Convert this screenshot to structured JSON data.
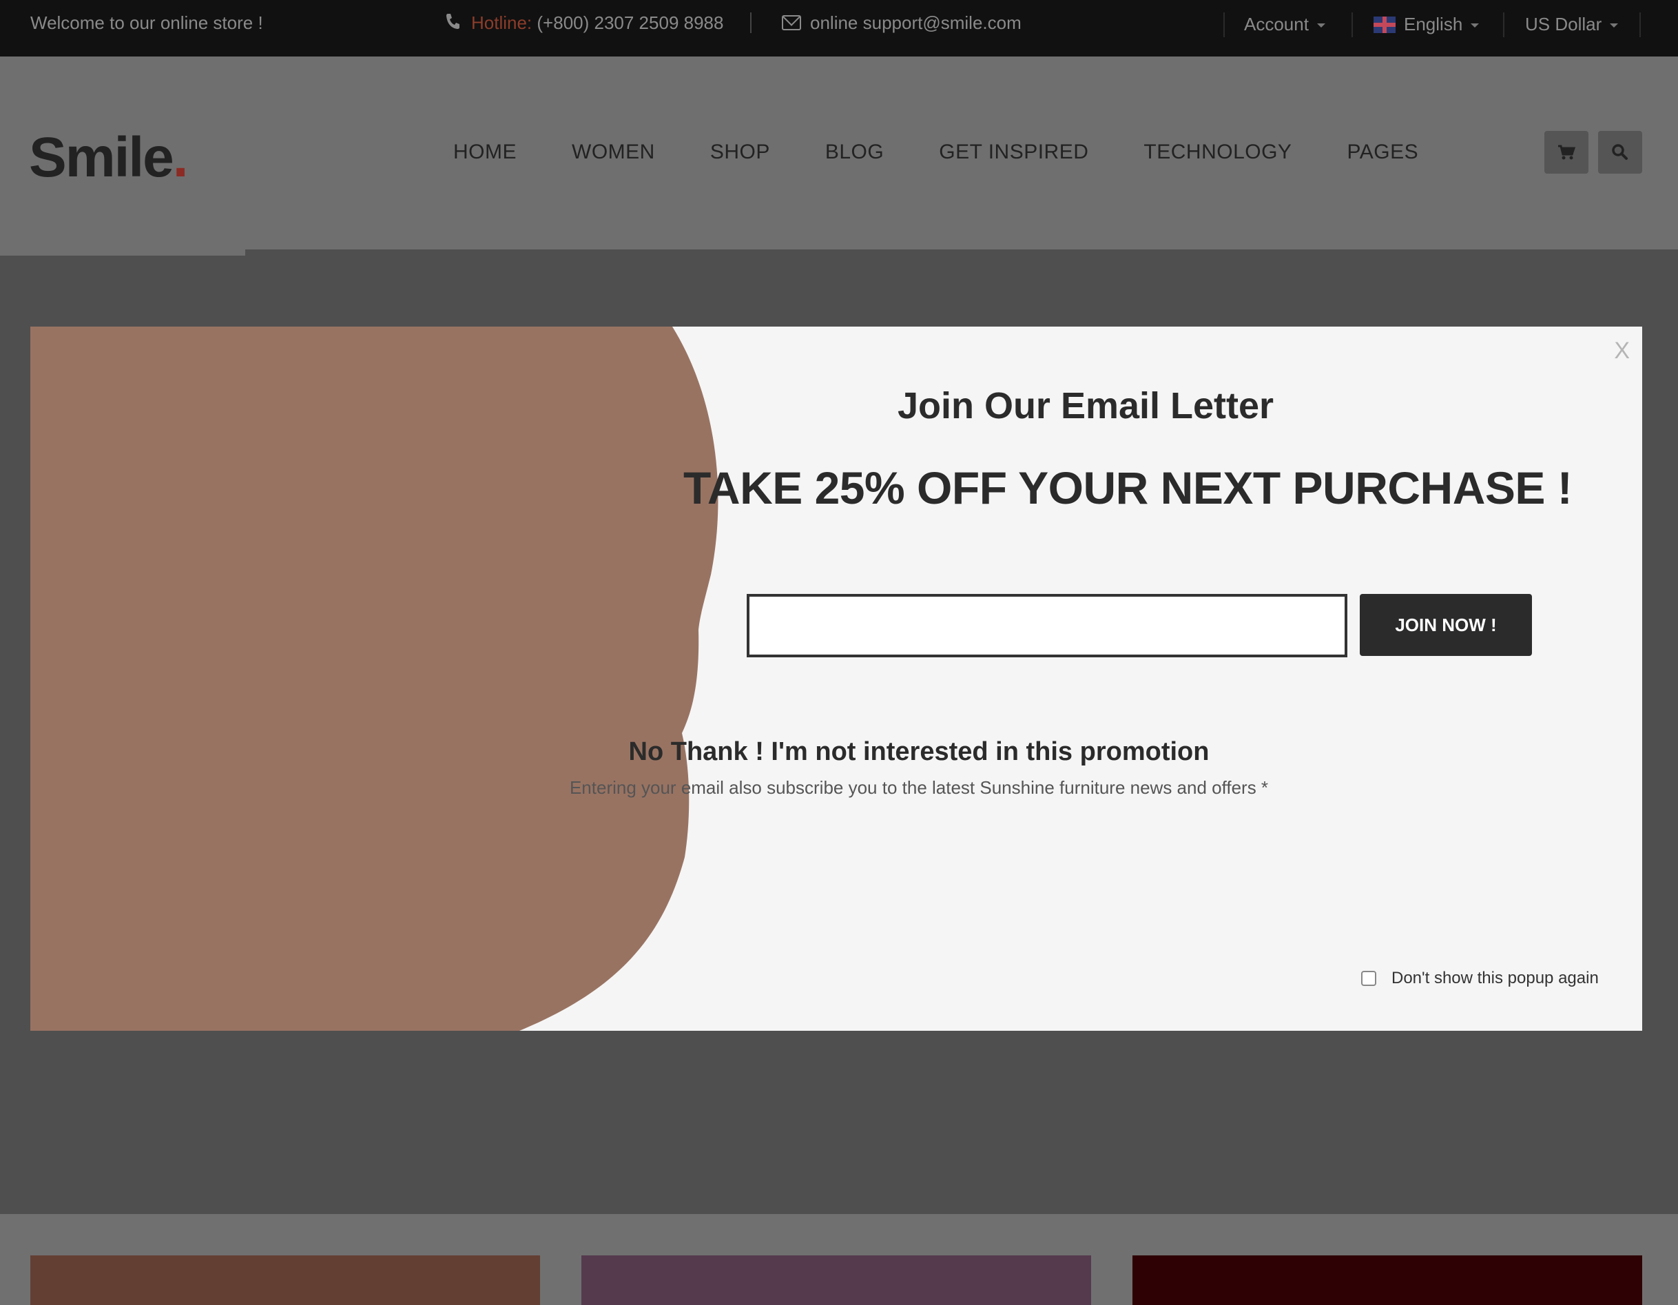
{
  "topbar": {
    "welcome": "Welcome to our online store !",
    "hotline_label": "Hotline:",
    "hotline_number": "(+800) 2307 2509 8988",
    "email": "online support@smile.com",
    "account": "Account",
    "language": "English",
    "currency": "US Dollar"
  },
  "header": {
    "logo": "Smile",
    "logo_dot": ".",
    "nav": [
      "HOME",
      "WOMEN",
      "SHOP",
      "BLOG",
      "GET INSPIRED",
      "TECHNOLOGY",
      "PAGES"
    ]
  },
  "popup": {
    "close": "X",
    "title": "Join Our Email Letter",
    "offer": "TAKE 25% OFF YOUR NEXT PURCHASE !",
    "email_placeholder": "",
    "join_button": "JOIN NOW !",
    "no_thanks": "No Thank ! I'm not interested in this promotion",
    "note": "Entering your email also subscribe you to the latest Sunshine furniture news and offers *",
    "dont_show": "Don't show this popup again",
    "dont_show_checked": false
  },
  "colors": {
    "hotline_accent": "#8c3d2a",
    "blob": "#997362",
    "card_1": "#633f33",
    "card_2": "#553a4e",
    "card_3": "#2e0204"
  }
}
